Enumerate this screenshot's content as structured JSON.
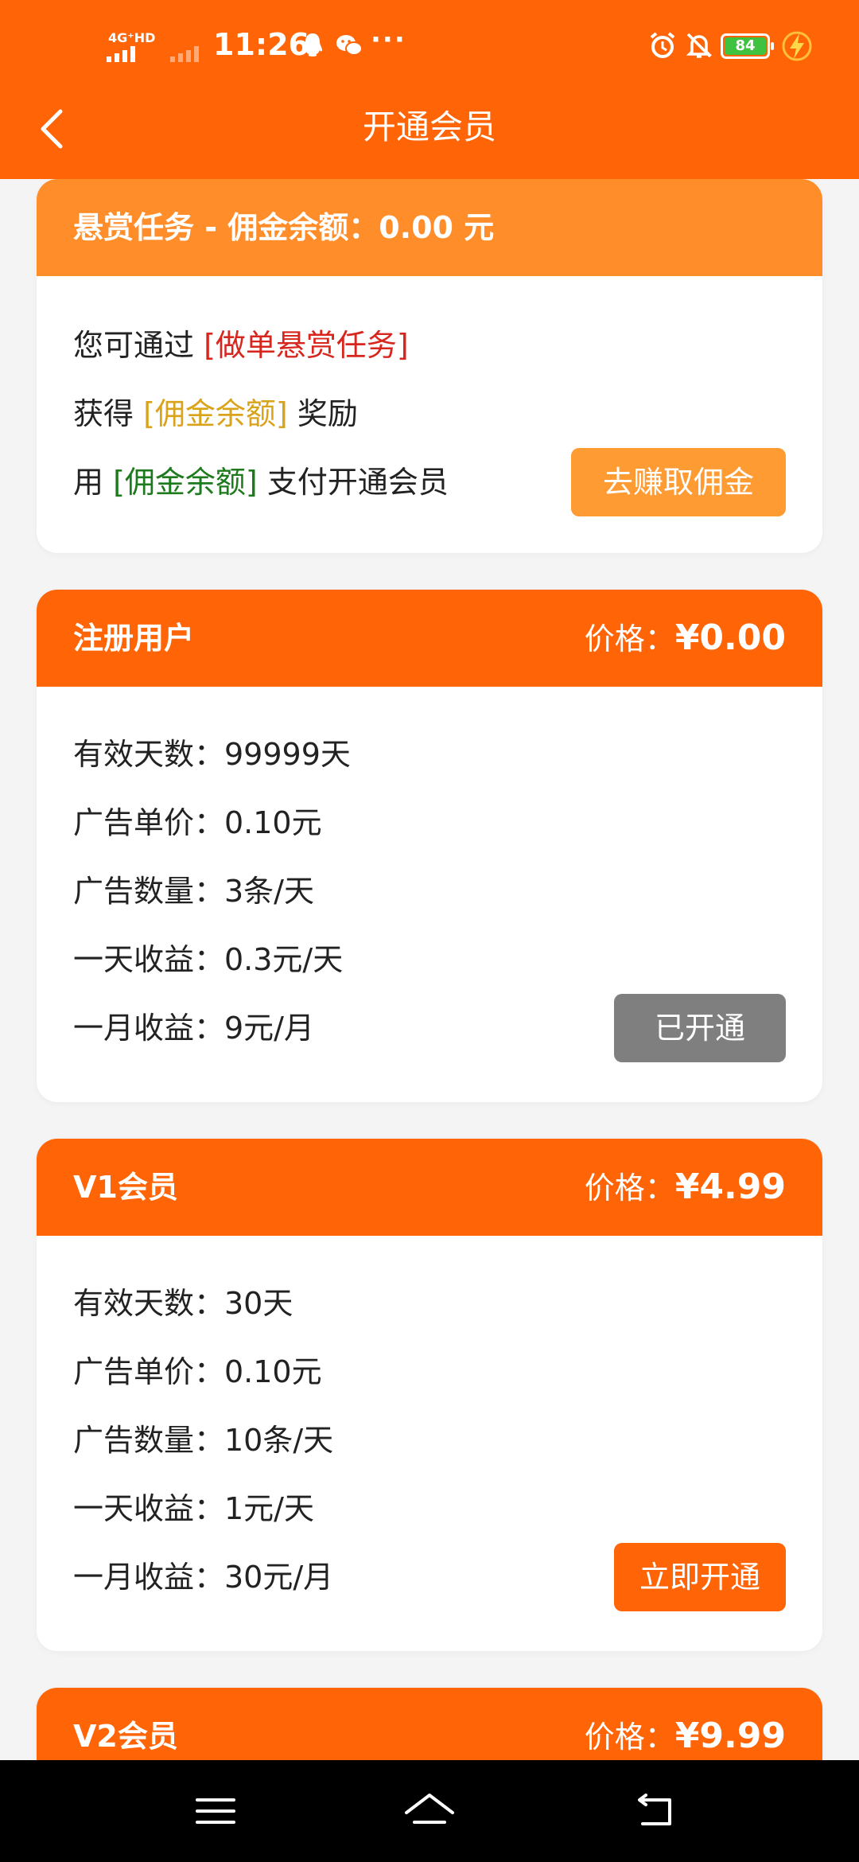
{
  "status_bar": {
    "network": "4G⁺HD",
    "time": "11:26",
    "more": "···",
    "battery": "84"
  },
  "header": {
    "title": "开通会员"
  },
  "reward_card": {
    "title": "悬赏任务 - 佣金余额：0.00 元",
    "line1_prefix": "您可通过 ",
    "line1_highlight": "[做单悬赏任务]",
    "line2_prefix": "获得 ",
    "line2_highlight": "[佣金余额]",
    "line2_suffix": " 奖励",
    "line3_prefix": "用 ",
    "line3_highlight": "[佣金余额]",
    "line3_suffix": " 支付开通会员",
    "button": "去赚取佣金"
  },
  "plans": [
    {
      "name": "注册用户",
      "price_label": "价格：",
      "price": "¥0.00",
      "details": [
        "有效天数：99999天",
        "广告单价：0.10元",
        "广告数量：3条/天",
        "一天收益：0.3元/天",
        "一月收益：9元/月"
      ],
      "button": "已开通"
    },
    {
      "name": "V1会员",
      "price_label": "价格：",
      "price": "¥4.99",
      "details": [
        "有效天数：30天",
        "广告单价：0.10元",
        "广告数量：10条/天",
        "一天收益：1元/天",
        "一月收益：30元/月"
      ],
      "button": "立即开通"
    },
    {
      "name": "V2会员",
      "price_label": "价格：",
      "price": "¥9.99"
    }
  ],
  "colors": {
    "primary": "#ff6406",
    "reward_header": "#ff8d2a",
    "red": "#d7261e",
    "gold": "#d9a31a",
    "green": "#1d7a1d",
    "disabled": "#7f7f7f"
  },
  "icons": {
    "qq": "qq-icon",
    "wechat": "wechat-icon",
    "alarm": "alarm-icon",
    "mute": "bell-off-icon",
    "charge": "charge-icon",
    "back": "back-icon",
    "menu": "menu-icon",
    "home": "home-icon",
    "return": "return-icon"
  }
}
